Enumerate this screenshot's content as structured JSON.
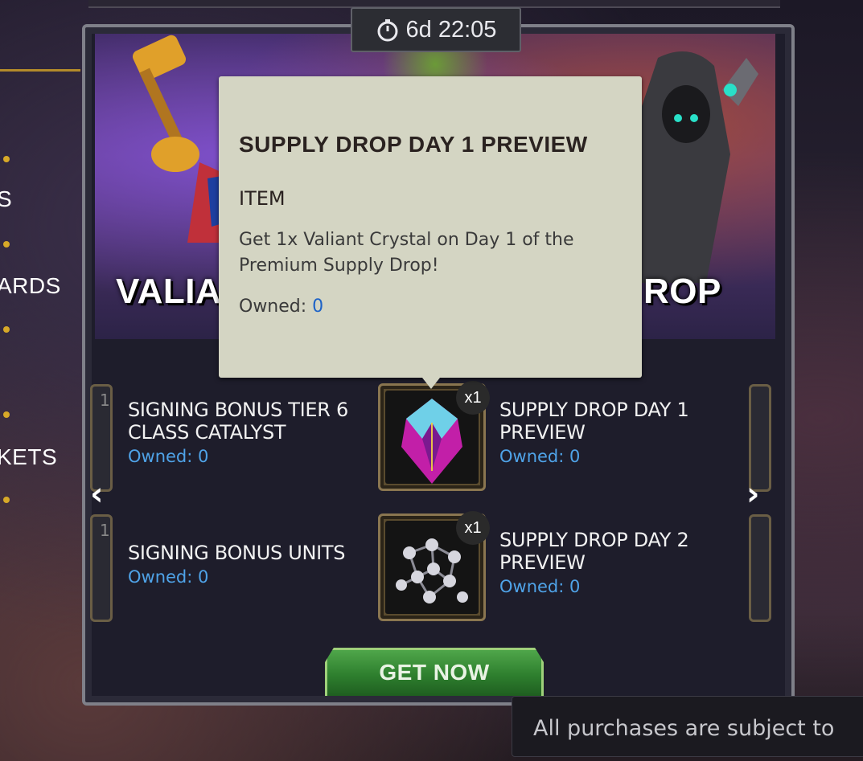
{
  "timer": {
    "text": "6d 22:05"
  },
  "sidebar": {
    "labels": [
      "S",
      "ARDS",
      "KETS"
    ]
  },
  "banner": {
    "title_left": "VALIA",
    "title_right": "ROP"
  },
  "items": [
    {
      "name_line1": "SIGNING BONUS TIER 6",
      "name_line2": "CLASS CATALYST",
      "owned_label": "Owned: 0"
    },
    {
      "name_line1": "SUPPLY DROP DAY 1",
      "name_line2": "PREVIEW",
      "owned_label": "Owned: 0",
      "qty": "x1"
    },
    {
      "name_line1": "SIGNING BONUS UNITS",
      "owned_label": "Owned: 0"
    },
    {
      "name_line1": "SUPPLY DROP DAY 2",
      "name_line2": "PREVIEW",
      "owned_label": "Owned: 0",
      "qty": "x1"
    }
  ],
  "edge_badges": {
    "left_top": "1",
    "left_bottom": "1"
  },
  "nav": {
    "prev": "‹",
    "next": "›"
  },
  "cta": {
    "label": "GET NOW"
  },
  "tooltip": {
    "title": "SUPPLY DROP DAY 1 PREVIEW",
    "type": "ITEM",
    "description": "Get 1x Valiant Crystal on Day 1 of the Premium Supply Drop!",
    "owned_label": "Owned:",
    "owned_value": "0"
  },
  "disclaimer": {
    "text": "All purchases are subject to"
  },
  "colors": {
    "owned_blue": "#4fa3e8",
    "tooltip_bg": "#d4d5c3",
    "cta_green": "#2e7f2e"
  }
}
